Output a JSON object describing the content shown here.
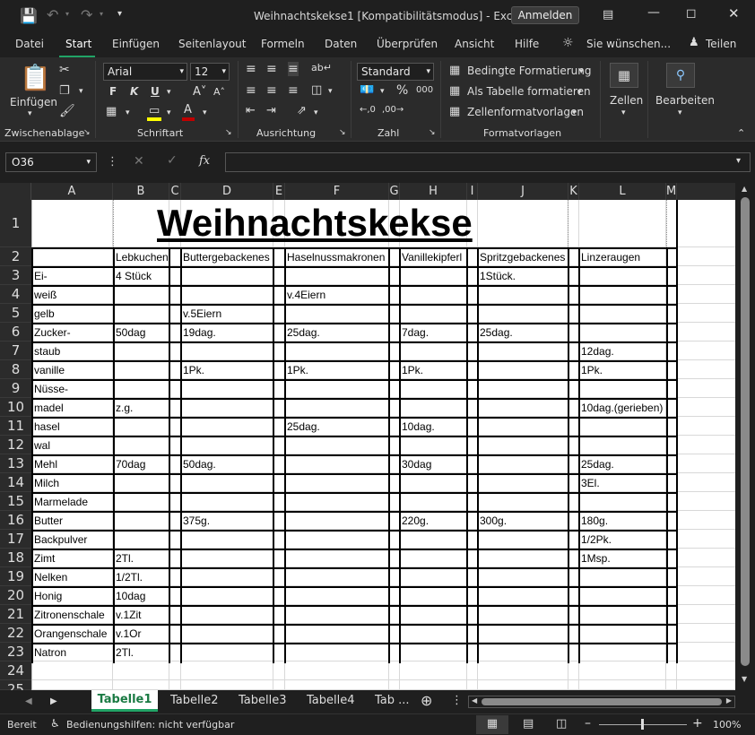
{
  "window": {
    "title": "Weihnachtskekse1  [Kompatibilitätsmodus]  -  Excel",
    "signin": "Anmelden"
  },
  "tabs": [
    "Datei",
    "Start",
    "Einfügen",
    "Seitenlayout",
    "Formeln",
    "Daten",
    "Überprüfen",
    "Ansicht",
    "Hilfe"
  ],
  "tellme": "Sie wünschen...",
  "share": "Teilen",
  "ribbon": {
    "paste": "Einfügen",
    "font_name": "Arial",
    "font_size": "12",
    "number_format": "Standard",
    "cond_format": "Bedingte Formatierung",
    "table_format": "Als Tabelle formatieren",
    "cell_styles": "Zellenformatvorlagen",
    "cells": "Zellen",
    "editing": "Bearbeiten",
    "bold": "F",
    "italic": "K",
    "underline": "U",
    "groups": [
      "Zwischenablage",
      "Schriftart",
      "Ausrichtung",
      "Zahl",
      "Formatvorlagen"
    ]
  },
  "formula": {
    "namebox": "O36",
    "fx": "fx",
    "value": ""
  },
  "columns": [
    "A",
    "B",
    "C",
    "D",
    "E",
    "F",
    "G",
    "H",
    "I",
    "J",
    "K",
    "L",
    "M"
  ],
  "rows": [
    "1",
    "2",
    "3",
    "4",
    "5",
    "6",
    "7",
    "8",
    "9",
    "10",
    "11",
    "12",
    "13",
    "14",
    "15",
    "16",
    "17",
    "18",
    "19",
    "20",
    "21",
    "22",
    "23",
    "24",
    "25"
  ],
  "sheet": {
    "title": "Weihnachtskekse",
    "headers": [
      "Lebkuchen",
      "Buttergebackenes",
      "Haselnussmakronen",
      "Vanillekipferl",
      "Spritzgebackenes",
      "Linzeraugen"
    ],
    "ingredients": [
      "Ei-",
      "weiß",
      "gelb",
      "Zucker-",
      "staub",
      "vanille",
      "Nüsse-",
      "madel",
      "hasel",
      "wal",
      "Mehl",
      "Milch",
      "Marmelade",
      "Butter",
      "Backpulver",
      "Zimt",
      "Nelken",
      "Honig",
      "Zitronenschale",
      "Orangenschale",
      "Natron"
    ],
    "values": [
      [
        "4 Stück",
        "",
        "",
        "",
        "1Stück.",
        ""
      ],
      [
        "",
        "",
        "v.4Eiern",
        "",
        "",
        ""
      ],
      [
        "",
        "v.5Eiern",
        "",
        "",
        "",
        ""
      ],
      [
        "50dag",
        "19dag.",
        "25dag.",
        "7dag.",
        "25dag.",
        ""
      ],
      [
        "",
        "",
        "",
        "",
        "",
        "12dag."
      ],
      [
        "",
        "1Pk.",
        "1Pk.",
        "1Pk.",
        "",
        "1Pk."
      ],
      [
        "",
        "",
        "",
        "",
        "",
        ""
      ],
      [
        "z.g.",
        "",
        "",
        "",
        "",
        "10dag.(gerieben)"
      ],
      [
        "",
        "",
        "25dag.",
        "10dag.",
        "",
        ""
      ],
      [
        "",
        "",
        "",
        "",
        "",
        ""
      ],
      [
        "70dag",
        "50dag.",
        "",
        "30dag",
        "",
        "25dag."
      ],
      [
        "",
        "",
        "",
        "",
        "",
        "3El."
      ],
      [
        "",
        "",
        "",
        "",
        "",
        ""
      ],
      [
        "",
        "375g.",
        "",
        "220g.",
        "300g.",
        "180g."
      ],
      [
        "",
        "",
        "",
        "",
        "",
        "1/2Pk."
      ],
      [
        "2Tl.",
        "",
        "",
        "",
        "",
        "1Msp."
      ],
      [
        "1/2Tl.",
        "",
        "",
        "",
        "",
        ""
      ],
      [
        "10dag",
        "",
        "",
        "",
        "",
        ""
      ],
      [
        "v.1Zit",
        "",
        "",
        "",
        "",
        ""
      ],
      [
        "v.1Or",
        "",
        "",
        "",
        "",
        ""
      ],
      [
        "2Tl.",
        "",
        "",
        "",
        "",
        ""
      ]
    ]
  },
  "sheettabs": [
    "Tabelle1",
    "Tabelle2",
    "Tabelle3",
    "Tabelle4",
    "Tab ..."
  ],
  "status": {
    "ready": "Bereit",
    "accessibility": "Bedienungshilfen: nicht verfügbar",
    "zoom": "100%"
  },
  "colors": {
    "accent": "#21a366",
    "underline": "#c00000",
    "highlight": "#ffff00"
  }
}
